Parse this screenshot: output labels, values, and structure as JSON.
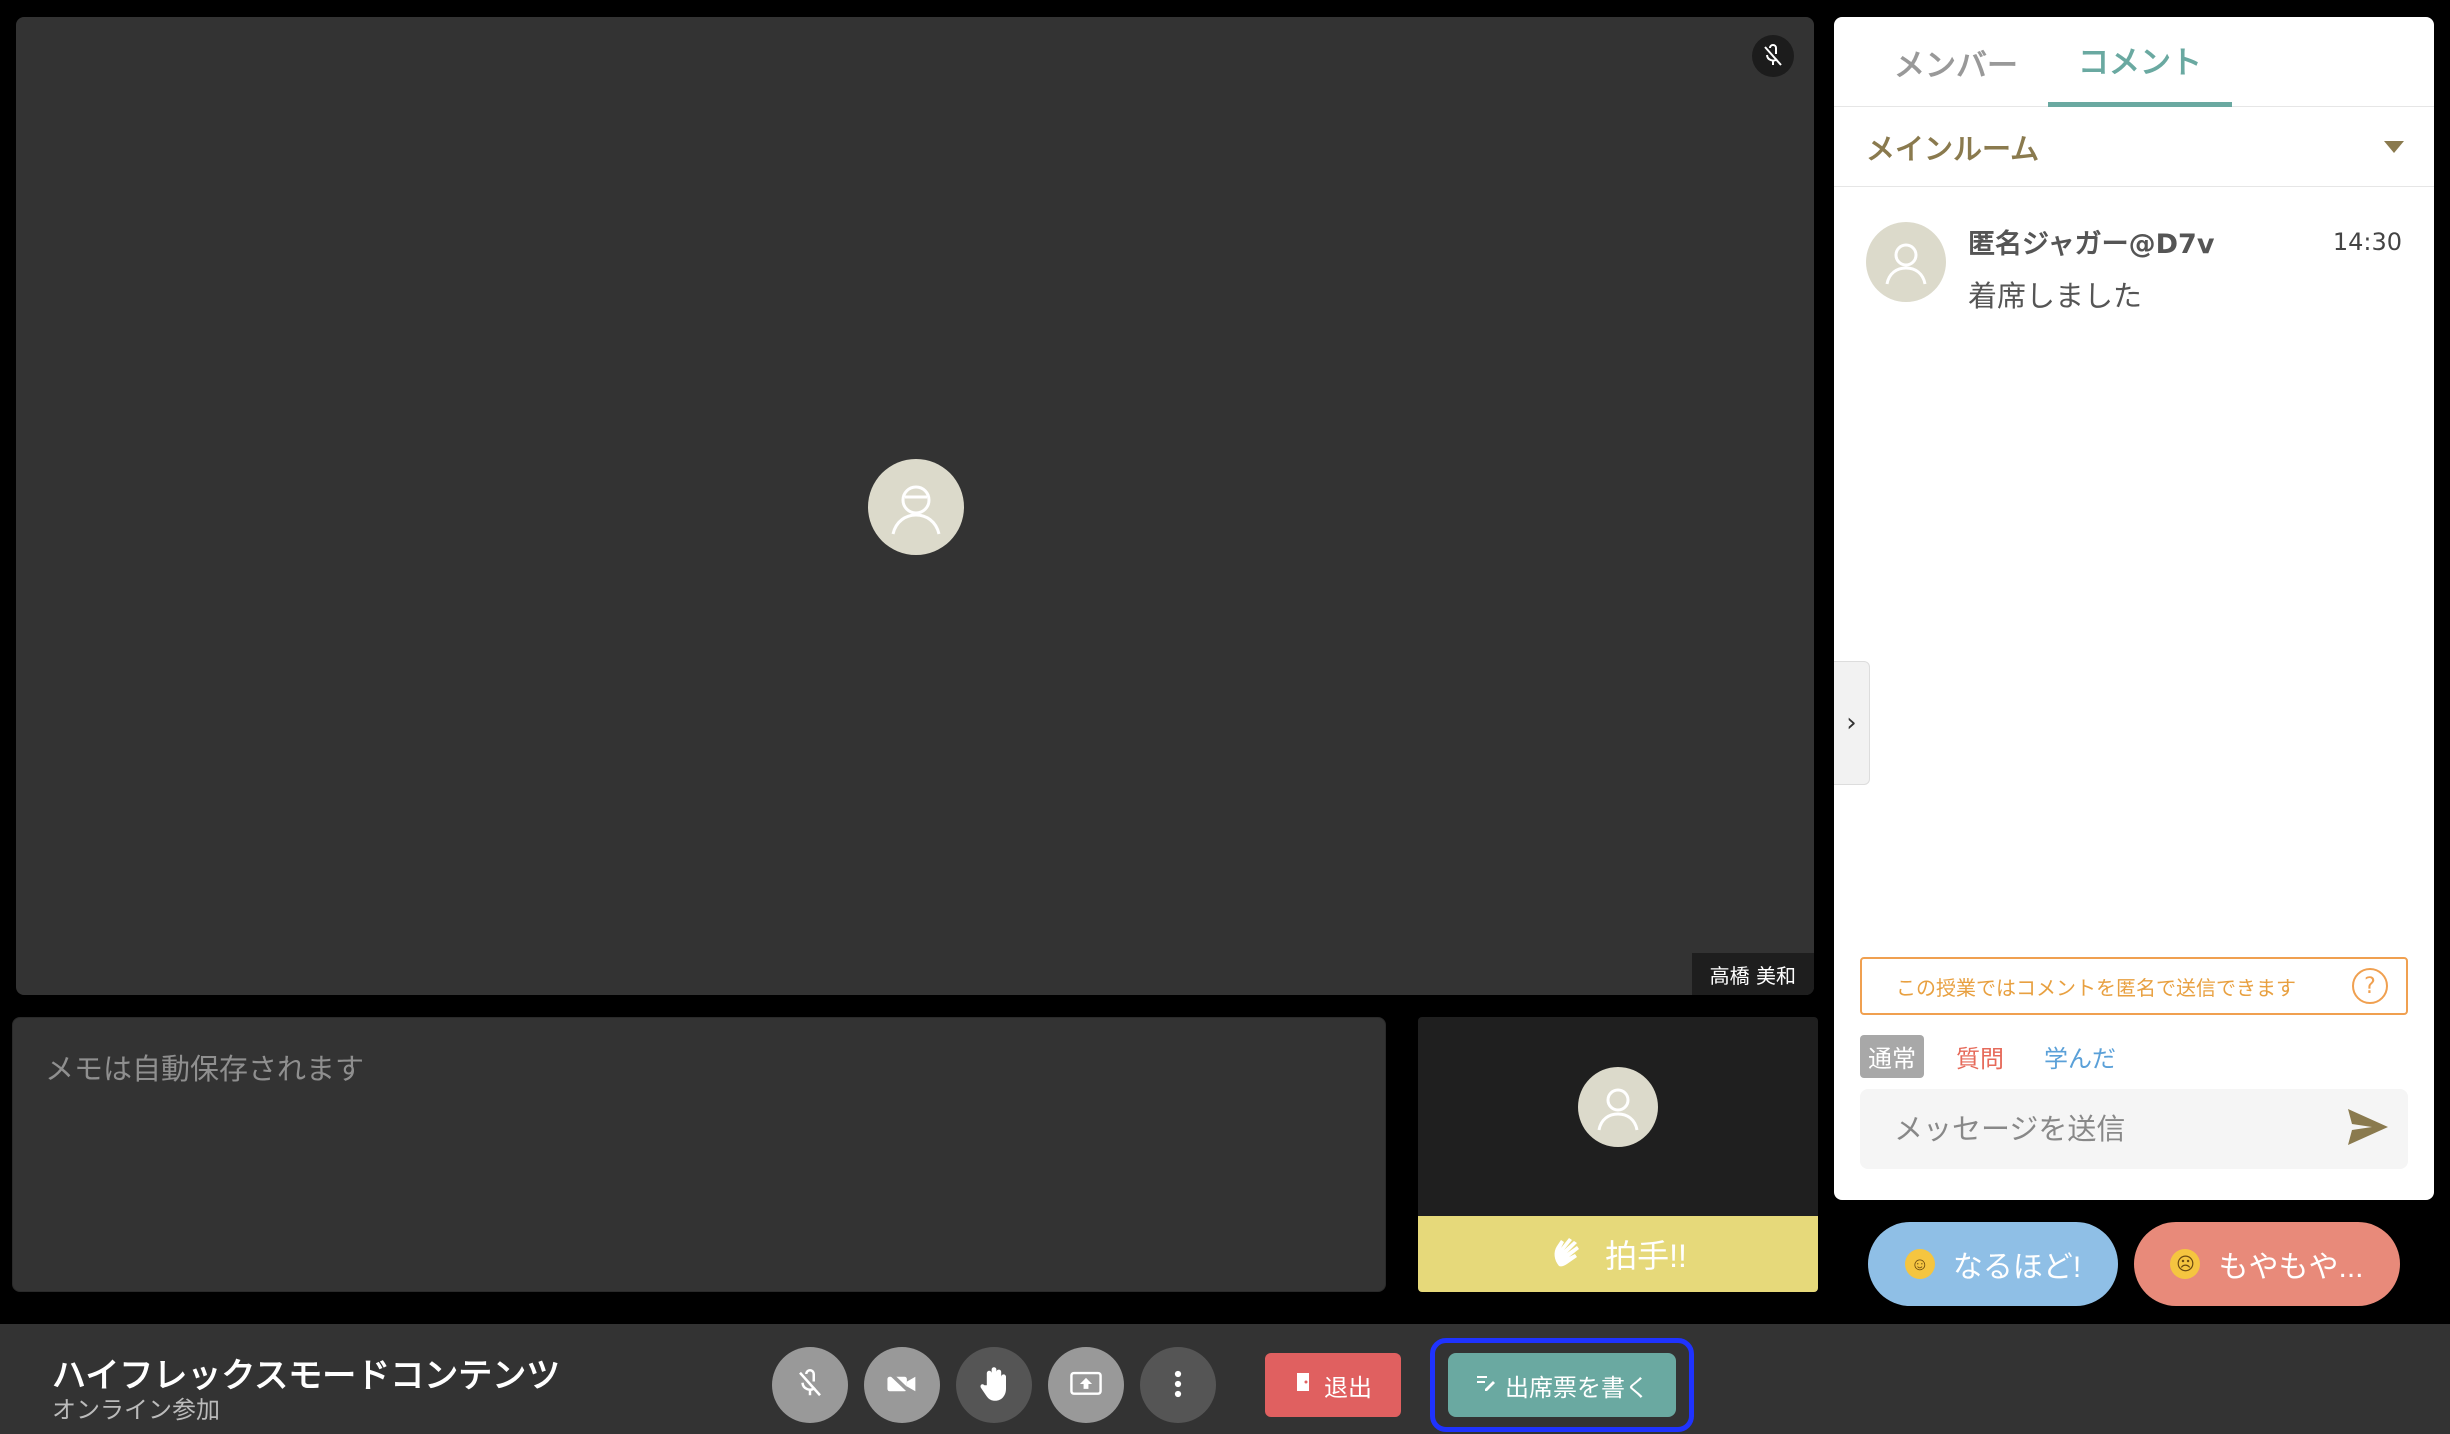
{
  "main_video": {
    "participant_name": "高橋 美和"
  },
  "memo": {
    "placeholder": "メモは自動保存されます"
  },
  "self_tile": {
    "clap_label": "拍手!!"
  },
  "panel": {
    "tabs": [
      {
        "label": "メンバー",
        "active": false
      },
      {
        "label": "コメント",
        "active": true
      }
    ],
    "room_select": "メインルーム",
    "comments": [
      {
        "author": "匿名ジャガー@D7v",
        "time": "14:30",
        "text": "着席しました"
      }
    ],
    "anon_note": "この授業ではコメントを匿名で送信できます",
    "comment_types": [
      "通常",
      "質問",
      "学んだ"
    ],
    "message_placeholder": "メッセージを送信"
  },
  "reactions": {
    "naruhodo": "なるほど!",
    "moyamoya": "もやもや..."
  },
  "bottom": {
    "title": "ハイフレックスモードコンテンツ",
    "subtitle": "オンライン参加",
    "leave_label": "退出",
    "attendance_label": "出席票を書く"
  },
  "colors": {
    "accent": "#6aa9a1",
    "leave": "#e06060",
    "clap": "#e6d97a",
    "naruhodo": "#8fbfe6",
    "moyamoya": "#e88a7a",
    "highlight": "#1f33ff"
  }
}
